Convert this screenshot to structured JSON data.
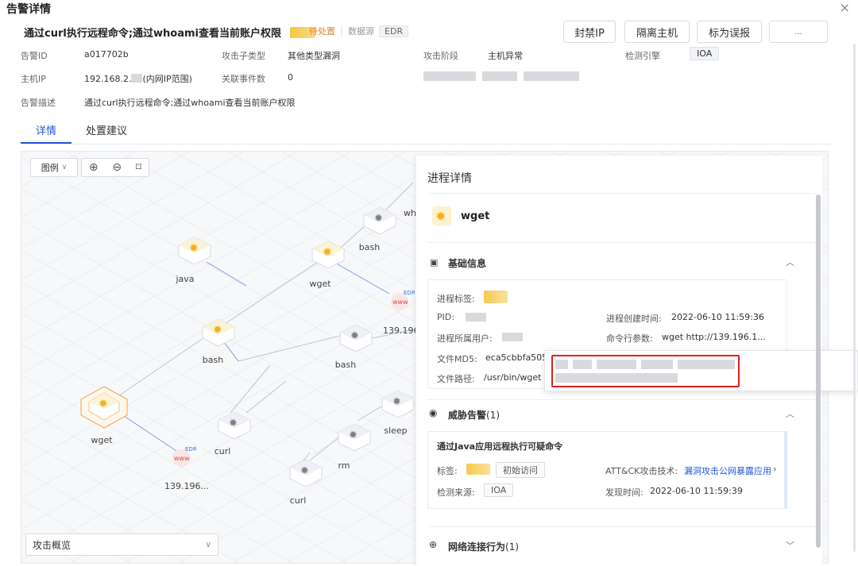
{
  "modal": {
    "title": "告警详情",
    "close": "×"
  },
  "alert": {
    "title": "通过curl执行远程命令;通过whoami查看当前账户权限",
    "status": "待处置",
    "source_label": "数据源",
    "source_value": "EDR"
  },
  "actions": [
    "封禁IP",
    "隔离主机",
    "标为误报",
    "..."
  ],
  "meta": {
    "alert_id_label": "告警ID",
    "alert_id": "a017702b",
    "attack_subtype_label": "攻击子类型",
    "attack_subtype": "其他类型漏洞",
    "attack_stage_label": "攻击阶段",
    "attack_stage": "主机异常",
    "engine_label": "检测引擎",
    "engine": "IOA",
    "host_ip_label": "主机IP",
    "host_ip": "192.168.2.",
    "host_ip_scope": "(内网IP范围)",
    "related_events_label": "关联事件数",
    "related_events": "0",
    "desc_label": "告警描述",
    "desc": "通过curl执行远程命令;通过whoami查看当前账户权限"
  },
  "tabs": [
    "详情",
    "处置建议"
  ],
  "graph": {
    "legend": "图例",
    "nodes": {
      "java": "java",
      "wget_top": "wget",
      "bash_top": "bash",
      "wh": "wh",
      "bash_mid": "bash",
      "bash_mid2": "bash",
      "ip_right": "139.196",
      "wget_selected": "wget",
      "curl_left": "curl",
      "sleep": "sleep",
      "ip_bottom": "139.196...",
      "rm": "rm",
      "curl_bottom": "curl",
      "edr_tag": "EDR",
      "www_tag": "www"
    },
    "overview_select": "攻击概览"
  },
  "panel": {
    "title": "进程详情",
    "process_name": "wget",
    "basic_info": {
      "title": "基础信息",
      "process_tag_label": "进程标签:",
      "pid_label": "PID:",
      "create_time_label": "进程创建时间:",
      "create_time": "2022-06-10 11:59:36",
      "user_label": "进程所属用户:",
      "cmdline_label": "命令行参数:",
      "cmdline": "wget http://139.196.1...",
      "md5_label": "文件MD5:",
      "md5": "eca5cbbfa505",
      "path_label": "文件路径:",
      "path": "/usr/bin/wget"
    },
    "threat": {
      "title": "威胁告警",
      "count": "(1)",
      "item_title": "通过Java应用远程执行可疑命令",
      "tag_label": "标签:",
      "tag_value": "初始访问",
      "attck_label": "ATT&CK攻击技术:",
      "attck_value": "漏洞攻击公网暴露应用",
      "source_label": "检测来源:",
      "source_value": "IOA",
      "found_time_label": "发现时间:",
      "found_time": "2022-06-10 11:59:39"
    },
    "network": {
      "title": "网络连接行为",
      "count": "(1)"
    }
  }
}
